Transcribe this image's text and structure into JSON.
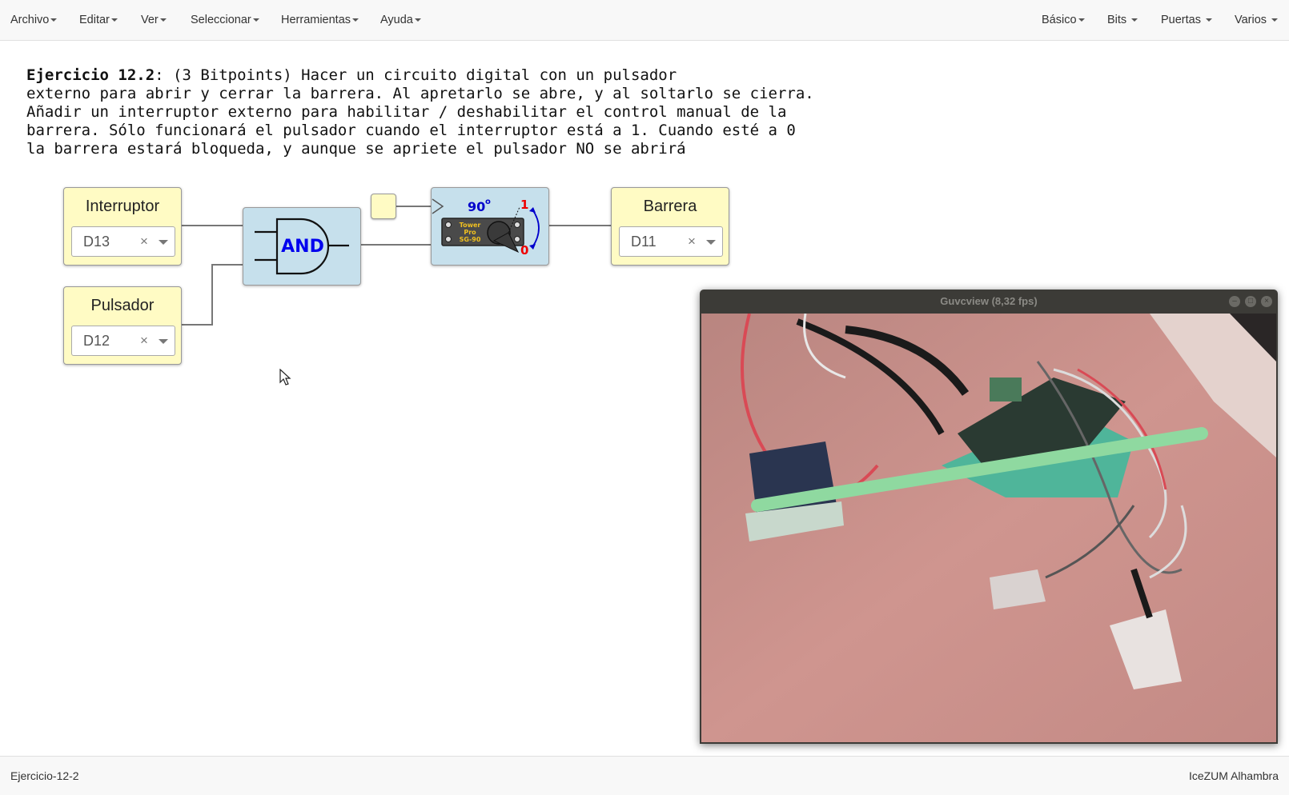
{
  "menu": {
    "left": [
      "Archivo",
      "Editar",
      "Ver",
      "Seleccionar",
      "Herramientas",
      "Ayuda"
    ],
    "right": [
      "Básico",
      "Bits",
      "Puertas",
      "Varios"
    ]
  },
  "description": {
    "bold": "Ejercicio 12.2",
    "line1": ": (3 Bitpoints) Hacer un circuito digital con un pulsador",
    "line2": "externo para abrir y cerrar la barrera. Al apretarlo se abre, y al soltarlo se cierra.",
    "line3": "Añadir un interruptor externo para habilitar / deshabilitar el control manual de la",
    "line4": "barrera. Sólo funcionará el pulsador cuando el interruptor está a 1. Cuando esté a 0",
    "line5": "la barrera estará bloqueda, y aunque se apriete el pulsador NO se abrirá"
  },
  "blocks": {
    "interruptor": {
      "title": "Interruptor",
      "pin": "D13"
    },
    "pulsador": {
      "title": "Pulsador",
      "pin": "D12"
    },
    "barrera": {
      "title": "Barrera",
      "pin": "D11"
    },
    "and_gate": {
      "label": "AND"
    },
    "servo": {
      "angle": "90",
      "degree": "o",
      "high": "1",
      "low": "0",
      "brand1": "Tower",
      "brand2": "Pro",
      "model": "SG-90"
    }
  },
  "pin_clear_symbol": "×",
  "camera_window": {
    "title": "Guvcview  (8,32 fps)"
  },
  "status": {
    "left": "Ejercicio-12-2",
    "right": "IceZUM Alhambra"
  },
  "colors": {
    "io_block": "#fffbc4",
    "gate_block": "#c6e0ec",
    "and_text": "#0000ee",
    "servo_angle": "#0000cc",
    "servo_high": "#ee0000",
    "wire": "#777777"
  },
  "icons": [
    "caret-down-icon",
    "clear-icon",
    "dropdown-arrow-icon",
    "and-gate-icon",
    "servo-icon",
    "mouse-pointer-icon",
    "minimize-icon",
    "maximize-icon",
    "close-icon"
  ]
}
